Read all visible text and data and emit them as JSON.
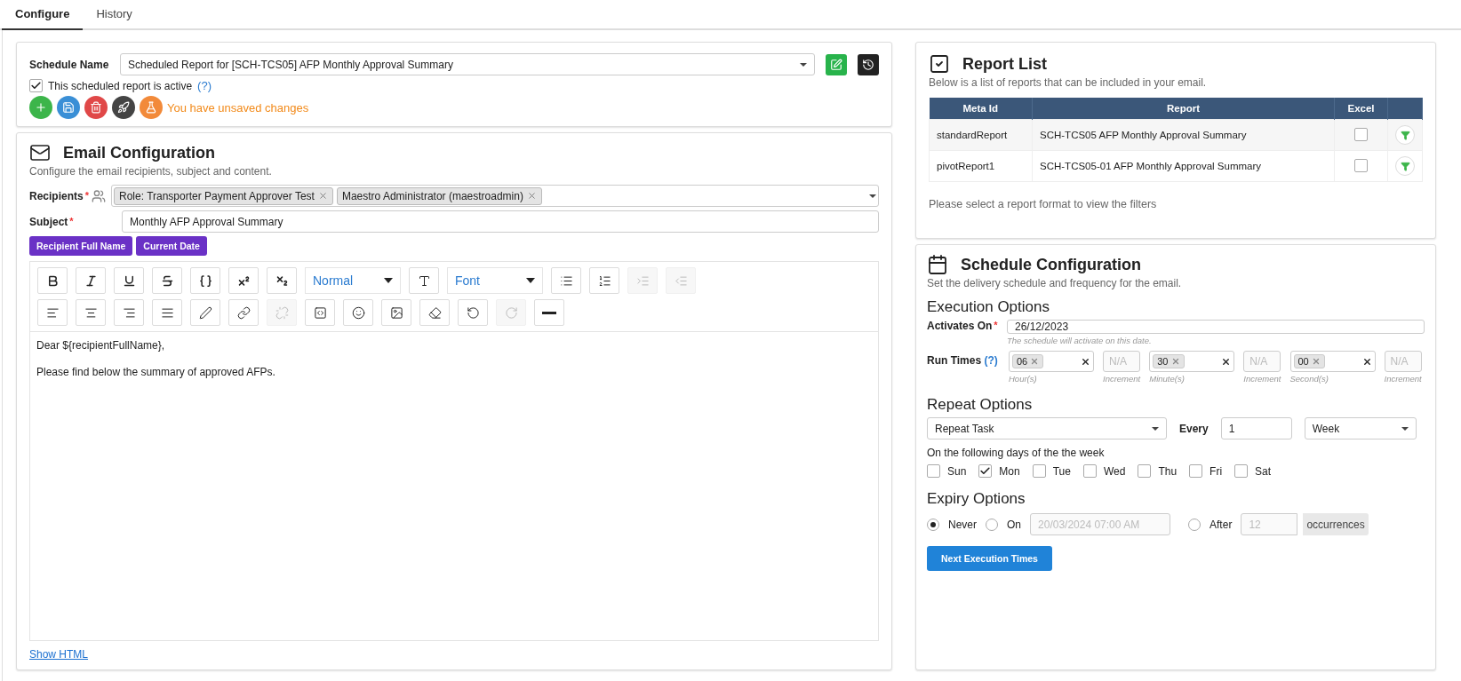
{
  "tabs": [
    {
      "label": "Configure",
      "selected": true
    },
    {
      "label": "History",
      "selected": false
    }
  ],
  "schedule": {
    "label": "Schedule Name",
    "value": "Scheduled Report for [SCH-TCS05] AFP Monthly Approval Summary",
    "active": {
      "label": "This scheduled report is active",
      "help": "(?)",
      "checked": true
    },
    "status": "You have unsaved changes"
  },
  "email": {
    "title": "Email Configuration",
    "subtitle": "Configure the email recipients, subject and content.",
    "recipients": {
      "label": "Recipients",
      "required": "*",
      "chips": [
        "Role: Transporter Payment Approver Test",
        "Maestro Administrator (maestroadmin)"
      ]
    },
    "subject": {
      "label": "Subject",
      "required": "*",
      "value": "Monthly AFP Approval Summary"
    },
    "tokens": [
      "Recipient Full Name",
      "Current Date"
    ],
    "toolbar": [
      [
        {
          "kind": "button",
          "disabled": false
        },
        {
          "kind": "button",
          "disabled": false
        },
        {
          "kind": "button",
          "disabled": false
        },
        {
          "kind": "button",
          "disabled": false
        },
        {
          "kind": "button",
          "disabled": false
        },
        {
          "kind": "button",
          "disabled": false
        },
        {
          "kind": "button",
          "disabled": false
        },
        {
          "kind": "dropdown",
          "label": "Normal"
        },
        {
          "kind": "button",
          "disabled": false
        },
        {
          "kind": "dropdown",
          "label": "Font"
        },
        {
          "kind": "button",
          "disabled": false
        },
        {
          "kind": "button",
          "disabled": false
        },
        {
          "kind": "button",
          "disabled": true
        },
        {
          "kind": "button",
          "disabled": true
        }
      ],
      [
        {
          "kind": "button",
          "disabled": false
        },
        {
          "kind": "button",
          "disabled": false
        },
        {
          "kind": "button",
          "disabled": false
        },
        {
          "kind": "button",
          "disabled": false
        },
        {
          "kind": "button",
          "disabled": false
        },
        {
          "kind": "button",
          "disabled": false
        },
        {
          "kind": "button",
          "disabled": true
        },
        {
          "kind": "button",
          "disabled": false
        },
        {
          "kind": "button",
          "disabled": false
        },
        {
          "kind": "button",
          "disabled": false
        },
        {
          "kind": "button",
          "disabled": false
        },
        {
          "kind": "button",
          "disabled": false
        },
        {
          "kind": "button",
          "disabled": true
        },
        {
          "kind": "button",
          "disabled": false
        }
      ]
    ],
    "body": [
      "Dear ${recipientFullName},",
      "Please find below the summary of approved AFPs."
    ],
    "show_html": "Show HTML"
  },
  "report_list": {
    "title": "Report List",
    "subtitle": "Below is a list of reports that can be included in your email.",
    "columns": [
      "Meta Id",
      "Report",
      "Excel"
    ],
    "rows": [
      {
        "meta_id": "standardReport",
        "report": "SCH-TCS05 AFP Monthly Approval Summary",
        "excel": false
      },
      {
        "meta_id": "pivotReport1",
        "report": "SCH-TCS05-01 AFP Monthly Approval Summary",
        "excel": false
      }
    ],
    "hint": "Please select a report format to view the filters"
  },
  "schedule_config": {
    "title": "Schedule Configuration",
    "subtitle": "Set the delivery schedule and frequency for the email.",
    "execution": {
      "heading": "Execution Options",
      "activates": {
        "label": "Activates On",
        "required": "*",
        "value": "26/12/2023",
        "help": "The schedule will activate on this date."
      },
      "run_times": {
        "label": "Run Times",
        "help": "(?)",
        "groups": [
          {
            "value": "06",
            "label": "Hour(s)",
            "increment": "N/A",
            "increment_label": "Increment"
          },
          {
            "value": "30",
            "label": "Minute(s)",
            "increment": "N/A",
            "increment_label": "Increment"
          },
          {
            "value": "00",
            "label": "Second(s)",
            "increment": "N/A",
            "increment_label": "Increment"
          }
        ]
      }
    },
    "repeat": {
      "heading": "Repeat Options",
      "mode": "Repeat Task",
      "every_label": "Every",
      "every": "1",
      "unit": "Week",
      "days_label": "On the following days of the the week",
      "days": [
        {
          "label": "Sun",
          "checked": false
        },
        {
          "label": "Mon",
          "checked": true
        },
        {
          "label": "Tue",
          "checked": false
        },
        {
          "label": "Wed",
          "checked": false
        },
        {
          "label": "Thu",
          "checked": false
        },
        {
          "label": "Fri",
          "checked": false
        },
        {
          "label": "Sat",
          "checked": false
        }
      ]
    },
    "expiry": {
      "heading": "Expiry Options",
      "options": [
        {
          "label": "Never",
          "selected": true
        },
        {
          "label": "On",
          "selected": false,
          "value": "20/03/2024 07:00 AM"
        },
        {
          "label": "After",
          "selected": false,
          "value": "12",
          "addon": "occurrences"
        }
      ]
    },
    "button": "Next Execution Times"
  }
}
